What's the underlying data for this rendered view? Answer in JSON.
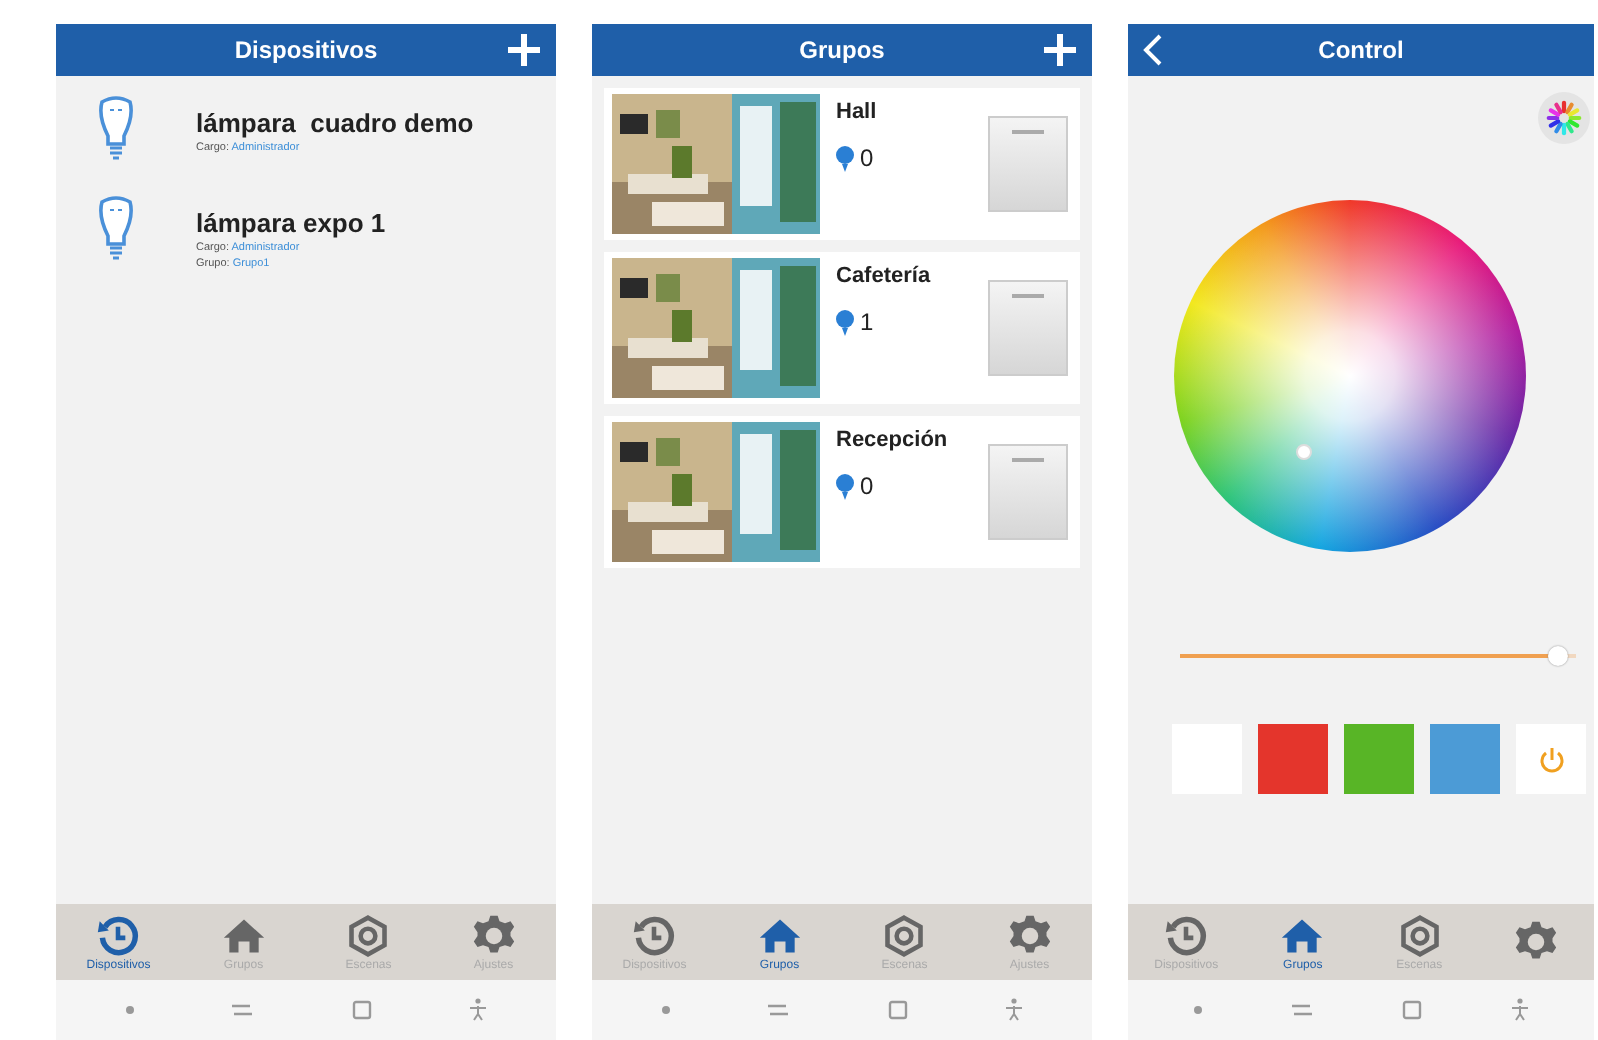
{
  "screens": [
    {
      "kind": "devices",
      "title": "Dispositivos",
      "add_button": true,
      "back_button": false,
      "devices": [
        {
          "name": "lámpara  cuadro demo",
          "fields": [
            {
              "label": "Cargo:",
              "value": "Administrador"
            }
          ]
        },
        {
          "name": "lámpara expo 1",
          "fields": [
            {
              "label": "Cargo:",
              "value": "Administrador"
            },
            {
              "label": "Grupo:",
              "value": "Grupo1"
            }
          ]
        }
      ],
      "tabs": [
        {
          "kind": "history",
          "label": "Dispositivos",
          "selected": true
        },
        {
          "kind": "home",
          "label": "Grupos",
          "selected": false
        },
        {
          "kind": "scene",
          "label": "Escenas",
          "selected": false
        },
        {
          "kind": "settings",
          "label": "Ajustes",
          "selected": false
        }
      ]
    },
    {
      "kind": "groups",
      "title": "Grupos",
      "add_button": true,
      "back_button": false,
      "groups": [
        {
          "name": "Hall",
          "count": "0"
        },
        {
          "name": "Cafetería",
          "count": "1"
        },
        {
          "name": "Recepción",
          "count": "0"
        }
      ],
      "tabs": [
        {
          "kind": "history",
          "label": "Dispositivos",
          "selected": false
        },
        {
          "kind": "home",
          "label": "Grupos",
          "selected": true
        },
        {
          "kind": "scene",
          "label": "Escenas",
          "selected": false
        },
        {
          "kind": "settings",
          "label": "Ajustes",
          "selected": false
        }
      ]
    },
    {
      "kind": "control",
      "title": "Control",
      "add_button": false,
      "back_button": true,
      "brightness": {
        "level": 0.98
      },
      "swatches": [
        {
          "kind": "color",
          "color": "#ffffff"
        },
        {
          "kind": "color",
          "color": "#e4352c"
        },
        {
          "kind": "color",
          "color": "#58b526"
        },
        {
          "kind": "color",
          "color": "#4c9bd6"
        },
        {
          "kind": "power"
        }
      ],
      "tabs": [
        {
          "kind": "history",
          "label": "Dispositivos",
          "selected": false
        },
        {
          "kind": "home",
          "label": "Grupos",
          "selected": true
        },
        {
          "kind": "scene",
          "label": "Escenas",
          "selected": false
        },
        {
          "kind": "settings",
          "selected": false
        }
      ]
    }
  ]
}
